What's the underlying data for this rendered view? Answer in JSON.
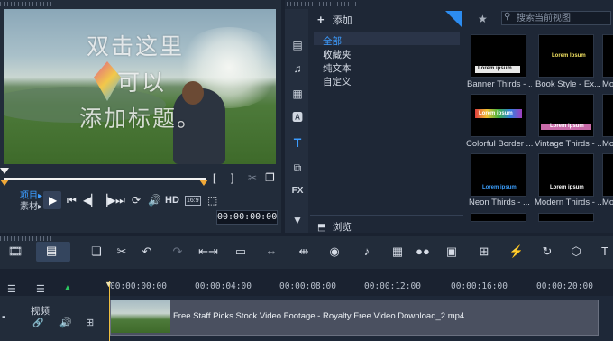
{
  "player": {
    "overlay_lines": [
      "双击这里",
      "可以",
      "添加标题。"
    ],
    "mode_project": "项目▸",
    "mode_clip": "素材▸",
    "hd_label": "HD",
    "ratio_label": "16:9",
    "timecode": "00:00:00:00",
    "progress": 0.0
  },
  "library": {
    "add_label": "添加",
    "folders": [
      "全部",
      "收藏夹",
      "纯文本",
      "自定义"
    ],
    "browse_label": "浏览",
    "search_placeholder": "搜索当前视图",
    "sidebar_fx": "FX",
    "thumbnails": [
      {
        "label": "Banner Thirds - ...",
        "text": "Lorem ipsum"
      },
      {
        "label": "Book Style - Ex...",
        "text": "Lorem Ipsum"
      },
      {
        "label": "Mo",
        "text": ""
      },
      {
        "label": "Colorful Border ...",
        "text": "Lorem ipsum"
      },
      {
        "label": "Vintage Thirds - ...",
        "text": "Lorem ipsum"
      },
      {
        "label": "Mo",
        "text": ""
      },
      {
        "label": "Neon Thirds - ...",
        "text": "Lorem ipsum"
      },
      {
        "label": "Modern Thirds - ...",
        "text": "Lorem ipsum"
      },
      {
        "label": "Mo",
        "text": ""
      }
    ]
  },
  "timeline": {
    "ticks": [
      "00:00:00:00",
      "00:00:04:00",
      "00:00:08:00",
      "00:00:12:00",
      "00:00:16:00",
      "00:00:20:00"
    ],
    "track_label": "视频",
    "clip_name": "Free Staff Picks Stock Video Footage - Royalty Free Video Download_2.mp4"
  },
  "colors": {
    "accent": "#3c9cff",
    "marker": "#f0a838"
  }
}
